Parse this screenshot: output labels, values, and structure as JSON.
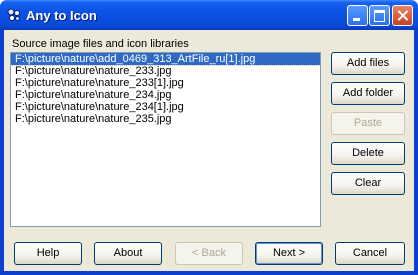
{
  "window": {
    "title": "Any to Icon"
  },
  "group_label": "Source image files and icon libraries",
  "files": [
    "F:\\picture\\nature\\add_0469_313_ArtFile_ru[1].jpg",
    "F:\\picture\\nature\\nature_233.jpg",
    "F:\\picture\\nature\\nature_233[1].jpg",
    "F:\\picture\\nature\\nature_234.jpg",
    "F:\\picture\\nature\\nature_234[1].jpg",
    "F:\\picture\\nature\\nature_235.jpg"
  ],
  "side_buttons": {
    "add_files": "Add files",
    "add_folder": "Add folder",
    "paste": "Paste",
    "delete": "Delete",
    "clear": "Clear"
  },
  "bottom_buttons": {
    "help": "Help",
    "about": "About",
    "back": "< Back",
    "next": "Next >",
    "cancel": "Cancel"
  }
}
